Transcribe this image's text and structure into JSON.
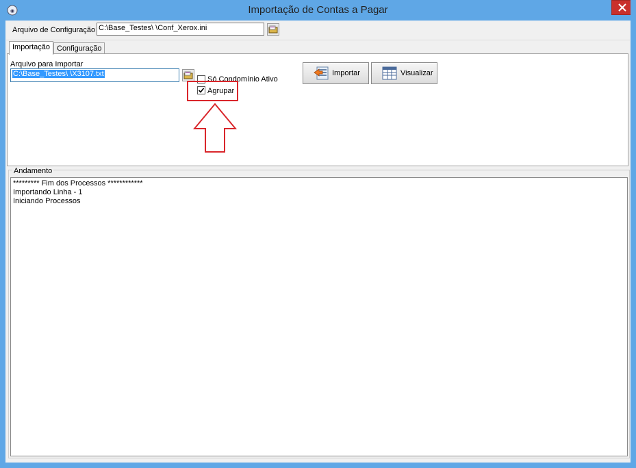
{
  "window": {
    "title": "Importação de Contas a Pagar"
  },
  "config": {
    "label": "Arquivo de Configuração",
    "value": "C:\\Base_Testes\\          \\Conf_Xerox.ini"
  },
  "tabs": [
    {
      "label": "Importação",
      "active": true
    },
    {
      "label": "Configuração",
      "active": false
    }
  ],
  "import": {
    "file_label": "Arquivo para Importar",
    "file_value": "C:\\Base_Testes\\        \\X3107.txt",
    "checkbox_condominio": {
      "label": "Só Condomínio Ativo",
      "checked": false
    },
    "checkbox_agrupar": {
      "label": "Agrupar",
      "checked": true
    },
    "btn_importar": "Importar",
    "btn_visualizar": "Visualizar"
  },
  "progress": {
    "group_label": "Andamento",
    "lines": [
      "********* Fim dos Processos ************",
      "Importando Linha - 1",
      "Iniciando Processos"
    ]
  },
  "colors": {
    "titlebar": "#5fa7e6",
    "close": "#c9302c",
    "highlight": "#d9262b",
    "selection": "#3399ff"
  }
}
